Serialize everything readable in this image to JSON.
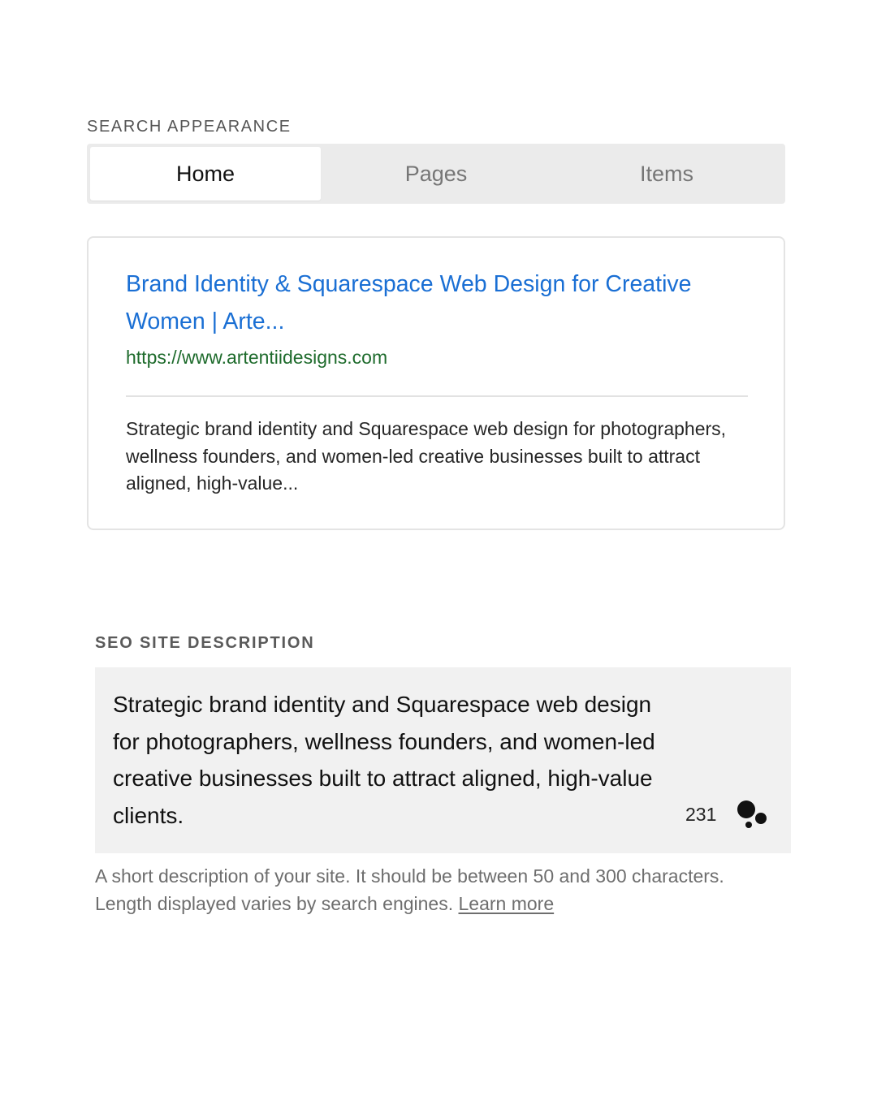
{
  "search_appearance": {
    "label": "SEARCH APPEARANCE",
    "tabs": [
      {
        "label": "Home",
        "active": true
      },
      {
        "label": "Pages",
        "active": false
      },
      {
        "label": "Items",
        "active": false
      }
    ],
    "preview": {
      "title_line1": "Brand Identity & Squarespace Web Design for Creative",
      "title_line2": "Women | Arte...",
      "url": "https://www.artentiidesigns.com",
      "description": "Strategic brand identity and Squarespace web design for photographers, wellness founders, and women-led creative businesses built to attract aligned, high-value..."
    }
  },
  "seo_description": {
    "label": "SEO SITE DESCRIPTION",
    "value": "Strategic brand identity and Squarespace web design for photographers, wellness founders, and women-led creative businesses built to attract aligned, high-value clients.",
    "char_count": "231",
    "assist_icon": "ai-assist-dots-icon",
    "help_text": "A short description of your site. It should be between 50 and 300 characters. Length displayed varies by search engines.",
    "learn_more_label": "Learn more"
  },
  "colors": {
    "title_link": "#1a6fd4",
    "url_green": "#1e6b2c",
    "tab_background": "#ebebeb",
    "field_background": "#f1f1f1"
  }
}
